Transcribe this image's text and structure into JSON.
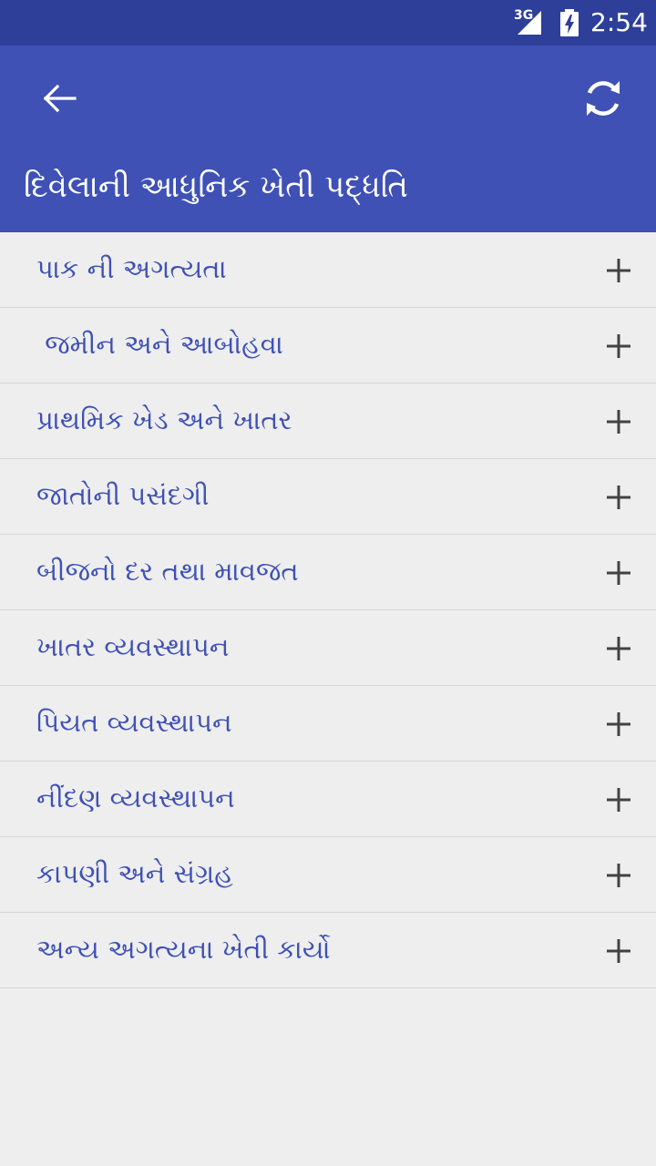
{
  "status_bar": {
    "network": "3G",
    "time": "2:54"
  },
  "app_bar": {
    "title": "દિવેલાની આધુનિક ખેતી પદ્ધતિ",
    "back_icon": "arrow-back-icon",
    "refresh_icon": "refresh-icon"
  },
  "sections": [
    {
      "label": "પાક ની અગત્યતા"
    },
    {
      "label": " જમીન અને આબોહવા"
    },
    {
      "label": "પ્રાથમિક ખેડ અને ખાતર"
    },
    {
      "label": "જાતોની પસંદગી"
    },
    {
      "label": "બીજનો દર તથા માવજત"
    },
    {
      "label": "ખાતર વ્યવસ્થાપન"
    },
    {
      "label": "પિયત વ્યવસ્થાપન"
    },
    {
      "label": "નીંદણ વ્યવસ્થાપન"
    },
    {
      "label": "કાપણી અને સંગ્રહ"
    },
    {
      "label": "અન્ય અગત્યના ખેતી કાર્યો"
    }
  ],
  "colors": {
    "status_bar": "#2e3f99",
    "app_bar": "#3f51b5",
    "background": "#eeeeee",
    "item_text": "#3f51b5",
    "divider": "#d6d6d6",
    "expand_icon": "#424242"
  },
  "expand_icon": "plus-icon"
}
